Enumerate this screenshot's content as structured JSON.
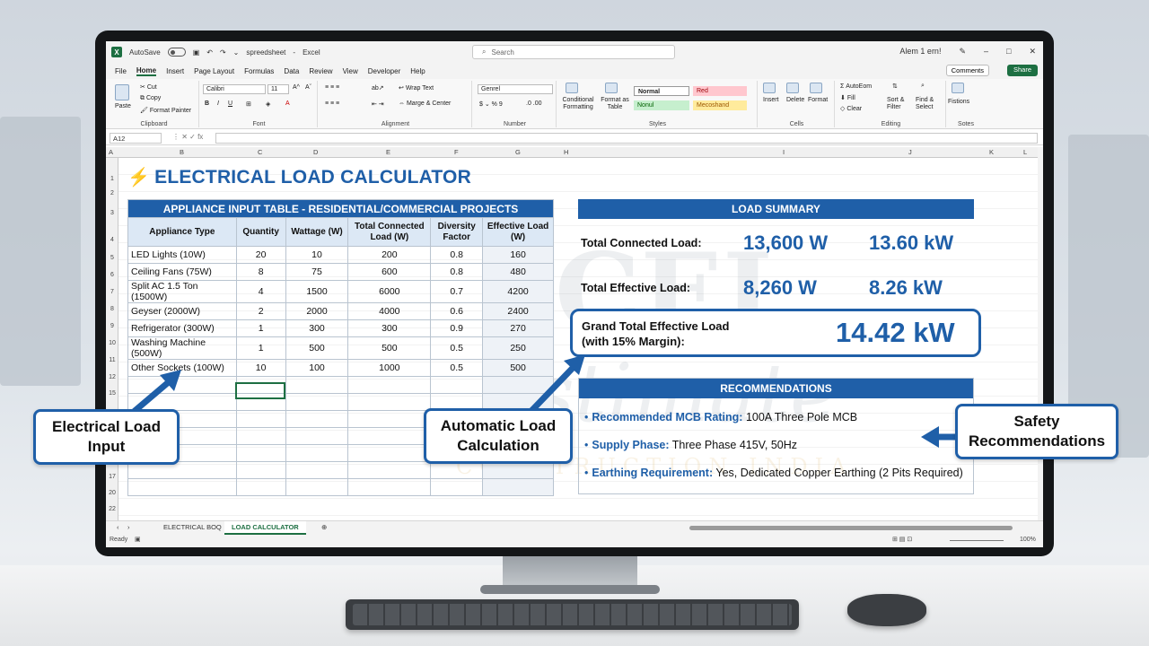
{
  "window": {
    "autosave_label": "AutoSave",
    "file_name": "spreedsheet",
    "app_name": "Excel",
    "search_placeholder": "Search",
    "user": "Alem 1 ern!"
  },
  "menu": [
    "File",
    "Home",
    "Insert",
    "Page Layout",
    "Formulas",
    "Data",
    "Review",
    "View",
    "Developer",
    "Help"
  ],
  "menu_active": "Home",
  "comments_label": "Comments",
  "share_label": "Share",
  "ribbon": {
    "clipboard": {
      "paste": "Paste",
      "cut": "Cut",
      "copy": "Copy",
      "format_painter": "Format Painter",
      "label": "Clipboard"
    },
    "font": {
      "name": "Calibri",
      "size": "11",
      "label": "Font"
    },
    "alignment": {
      "wrap": "Wrap Text",
      "merge": "Marge & Center",
      "label": "Alignment"
    },
    "number": {
      "format": "Genrel",
      "label": "Number"
    },
    "styles": {
      "conditional": "Conditional Formatting",
      "format_as_table": "Format as Table",
      "normal": "Normal",
      "bad": "Red",
      "good": "Nonul",
      "neutral": "Mecoshand",
      "label": "Styles"
    },
    "cells": {
      "insert": "Insert",
      "delete": "Delete",
      "format": "Format",
      "label": "Cells"
    },
    "editing": {
      "autosum": "AutoEom",
      "fill": "Fill",
      "clear": "Clear",
      "sort": "Sort & Filter",
      "find": "Find & Select",
      "label": "Editing"
    },
    "notes": {
      "button": "Fistions",
      "label": "Sotes"
    }
  },
  "formula_bar": {
    "cell_ref": "A12",
    "fx": "fx"
  },
  "columns": [
    "A",
    "B",
    "C",
    "D",
    "E",
    "F",
    "G",
    "H",
    "I",
    "J",
    "K",
    "L"
  ],
  "rows": [
    "1",
    "2",
    "3",
    "4",
    "5",
    "6",
    "7",
    "8",
    "9",
    "10",
    "11",
    "12",
    "15",
    "",
    "",
    "",
    "",
    "",
    "17",
    "20",
    "22"
  ],
  "title": "ELECTRICAL LOAD CALCULATOR",
  "appliance_table": {
    "banner": "APPLIANCE INPUT TABLE - RESIDENTIAL/COMMERCIAL PROJECTS",
    "headers": [
      "Appliance Type",
      "Quantity",
      "Wattage (W)",
      "Total Connected Load (W)",
      "Diversity Factor",
      "Effective Load (W)"
    ],
    "rows": [
      [
        "LED Lights (10W)",
        "20",
        "10",
        "200",
        "0.8",
        "160"
      ],
      [
        "Ceiling Fans (75W)",
        "8",
        "75",
        "600",
        "0.8",
        "480"
      ],
      [
        "Split AC 1.5 Ton (1500W)",
        "4",
        "1500",
        "6000",
        "0.7",
        "4200"
      ],
      [
        "Geyser (2000W)",
        "2",
        "2000",
        "4000",
        "0.6",
        "2400"
      ],
      [
        "Refrigerator (300W)",
        "1",
        "300",
        "300",
        "0.9",
        "270"
      ],
      [
        "Washing Machine (500W)",
        "1",
        "500",
        "500",
        "0.5",
        "250"
      ],
      [
        "Other Sockets (100W)",
        "10",
        "100",
        "1000",
        "0.5",
        "500"
      ]
    ]
  },
  "summary": {
    "banner": "LOAD SUMMARY",
    "connected_label": "Total Connected Load:",
    "connected_w": "13,600 W",
    "connected_kw": "13.60 kW",
    "effective_label": "Total Effective Load:",
    "effective_w": "8,260 W",
    "effective_kw": "8.26 kW",
    "grand_label_1": "Grand Total Effective Load",
    "grand_label_2": "(with 15% Margin):",
    "grand_value": "14.42 kW"
  },
  "recommendations": {
    "banner": "RECOMMENDATIONS",
    "items": [
      {
        "key": "Recommended MCB Rating:",
        "value": "100A Three Pole MCB"
      },
      {
        "key": "Supply Phase:",
        "value": "Three Phase 415V, 50Hz"
      },
      {
        "key": "Earthing Requirement:",
        "value": "Yes, Dedicated Copper Earthing (2 Pits Required)"
      }
    ]
  },
  "callouts": {
    "input": "Electrical Load Input",
    "calc": "Automatic Load Calculation",
    "safety": "Safety Recommendations"
  },
  "sheet_tabs": [
    "ELECTRICAL BOQ",
    "LOAD CALCULATOR"
  ],
  "sheet_tab_active": "LOAD CALCULATOR",
  "status": {
    "ready": "Ready",
    "zoom": "100%"
  },
  "watermark": {
    "big": "CEI",
    "script": "Estimate",
    "small": "CONSTRUCTION INDIA"
  },
  "colors": {
    "accent": "#1f5fa8",
    "excel_green": "#1d6f42",
    "header_fill": "#dce8f5"
  }
}
